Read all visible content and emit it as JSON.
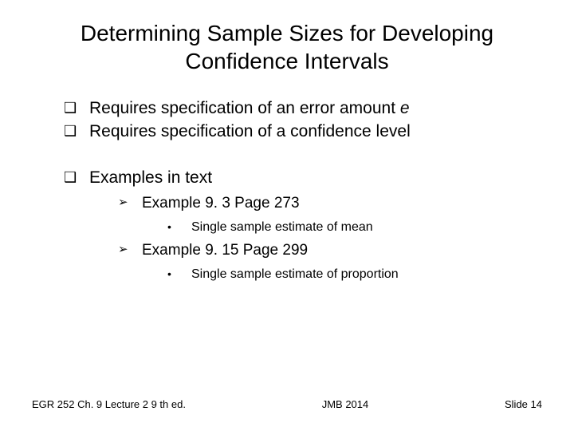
{
  "title": "Determining Sample Sizes for Developing Confidence Intervals",
  "l1": {
    "item1_prefix": "Requires specification of an error amount ",
    "item1_em": "е",
    "item2": "Requires specification of a confidence level",
    "item3": "Examples in text"
  },
  "l2": {
    "ex1": "Example 9. 3 Page 273",
    "ex2": "Example 9. 15 Page 299"
  },
  "l3": {
    "d1": "Single sample estimate of mean",
    "d2": "Single sample estimate of proportion"
  },
  "markers": {
    "square": "❑",
    "arrow": "➢",
    "dot": "•"
  },
  "footer": {
    "left": "EGR 252  Ch. 9 Lecture 2 9 th ed.",
    "center": "JMB 2014",
    "right": "Slide  14"
  }
}
